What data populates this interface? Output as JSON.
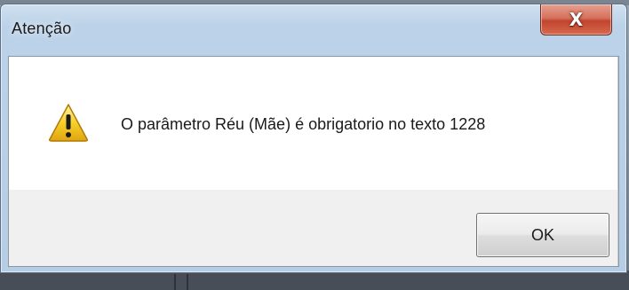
{
  "dialog": {
    "title": "Atenção",
    "close_label": "X",
    "icon": "warning-icon",
    "message": "O parâmetro Réu (Mãe) é obrigatorio no texto 1228",
    "ok_label": "OK"
  },
  "colors": {
    "close_button": "#c7472f",
    "warning_fill": "#f5c518",
    "content_background": "#ffffff",
    "footer_background": "#f0f0f0"
  }
}
